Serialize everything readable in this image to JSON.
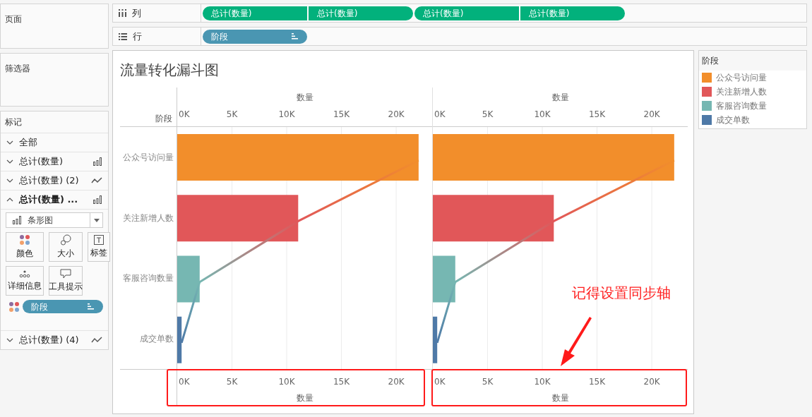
{
  "left_panel": {
    "pages": {
      "title": "页面"
    },
    "filters": {
      "title": "筛选器"
    },
    "marks": {
      "title": "标记",
      "layers": [
        {
          "label": "全部",
          "expanded": false,
          "kind": "none"
        },
        {
          "label": "总计(数量)",
          "expanded": false,
          "kind": "bar"
        },
        {
          "label": "总计(数量) (2)",
          "expanded": false,
          "kind": "line"
        },
        {
          "label": "总计(数量) ...",
          "expanded": true,
          "kind": "bar"
        },
        {
          "label": "总计(数量) (4)",
          "expanded": false,
          "kind": "line"
        }
      ],
      "mark_type": "条形图",
      "cards": [
        {
          "label": "颜色",
          "kind": "color"
        },
        {
          "label": "大小",
          "kind": "size"
        },
        {
          "label": "标签",
          "kind": "label"
        },
        {
          "label": "详细信息",
          "kind": "detail"
        },
        {
          "label": "工具提示",
          "kind": "tooltip"
        }
      ],
      "pill": "阶段"
    }
  },
  "shelves": [
    {
      "label": "列",
      "kind": "columns",
      "pills": [
        "总计(数量)",
        "总计(数量)",
        "总计(数量)",
        "总计(数量)"
      ]
    },
    {
      "label": "行",
      "kind": "rows",
      "pills": [
        "阶段"
      ]
    }
  ],
  "worksheet": {
    "title": "流量转化漏斗图",
    "row_header": "阶段",
    "panes": [
      {
        "chart_data": {
          "type": "bar",
          "orientation": "horizontal",
          "grid": true,
          "xlabel": "数量",
          "categories": [
            "公众号访问量",
            "关注新增人数",
            "客服咨询数量",
            "成交单数"
          ],
          "xlim": [
            0,
            23350
          ],
          "xticks": [
            {
              "value": 0,
              "label": "0K"
            },
            {
              "value": 5000,
              "label": "5K"
            },
            {
              "value": 10000,
              "label": "10K"
            },
            {
              "value": 15000,
              "label": "15K"
            },
            {
              "value": 20000,
              "label": "20K"
            }
          ],
          "series": [
            {
              "values": [
                22050,
                11050,
                2050,
                400
              ]
            }
          ]
        }
      },
      {
        "chart_data": {
          "type": "bar",
          "orientation": "horizontal",
          "grid": true,
          "xlabel": "数量",
          "xlim": [
            0,
            23350
          ],
          "xticks": [
            {
              "value": 0,
              "label": "0K"
            },
            {
              "value": 5000,
              "label": "5K"
            },
            {
              "value": 10000,
              "label": "10K"
            },
            {
              "value": 15000,
              "label": "15K"
            },
            {
              "value": 20000,
              "label": "20K"
            }
          ],
          "series": [
            {
              "values": [
                22050,
                11050,
                2050,
                400
              ]
            }
          ]
        }
      }
    ]
  },
  "legend": {
    "title": "阶段",
    "items": [
      {
        "label": "公众号访问量",
        "color": "#f28e2b"
      },
      {
        "label": "关注新增人数",
        "color": "#e15759"
      },
      {
        "label": "客服咨询数量",
        "color": "#76b7b2"
      },
      {
        "label": "成交单数",
        "color": "#4e79a7"
      }
    ]
  },
  "annotation": {
    "text": "记得设置同步轴"
  }
}
